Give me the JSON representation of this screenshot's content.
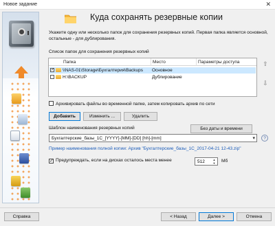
{
  "window": {
    "title": "Новое задание",
    "close_glyph": "✕"
  },
  "header": {
    "title": "Куда сохранять резервные копии"
  },
  "description": "Укажите одну или несколько папок для сохранения резервных копий. Первая папка является основной, остальные - для дублирования.",
  "list": {
    "label": "Список папок для сохранения резервных копий",
    "columns": [
      "Папка",
      "Место",
      "Параметры доступа"
    ],
    "rows": [
      {
        "checked": true,
        "path": "\\\\NAS-01\\Storage\\Бухгалтерия\\Backups",
        "place": "Основное"
      },
      {
        "checked": false,
        "path": "H:\\BACKUP",
        "place": "Дублирование"
      }
    ]
  },
  "archive_temp": {
    "checked": false,
    "label": "Архивировать файлы во временной папке, затем копировать архив по сети"
  },
  "buttons": {
    "add": "Добавить",
    "edit": "Изменить ...",
    "delete": "Удалить",
    "no_datetime": "Без даты и времени",
    "help": "Справка",
    "back": "< Назад",
    "next": "Далее >",
    "cancel": "Отмена"
  },
  "template": {
    "label": "Шаблон наименования резервных копий",
    "value": "Бухгалтерские_базы_1С_[YYYY]-[MM]-[DD] [hh]-[mm]",
    "example": "Пример наименования полной копии: Архив \"Бухгалтерские_базы_1С_2017-04-21 12-43.zip\""
  },
  "warn_space": {
    "checked": true,
    "label": "Предупреждать, если на дисках осталось места менее",
    "value": "512",
    "unit": "Мб"
  },
  "icons": {
    "side_up": "arrow-up-icon",
    "side_down": "arrow-down-icon",
    "help": "help-icon"
  },
  "colors": {
    "accent": "#0078d7",
    "selected_row": "#cce8ff",
    "example_link": "#1a5bb8",
    "banner_dots": "#f08a2a"
  }
}
